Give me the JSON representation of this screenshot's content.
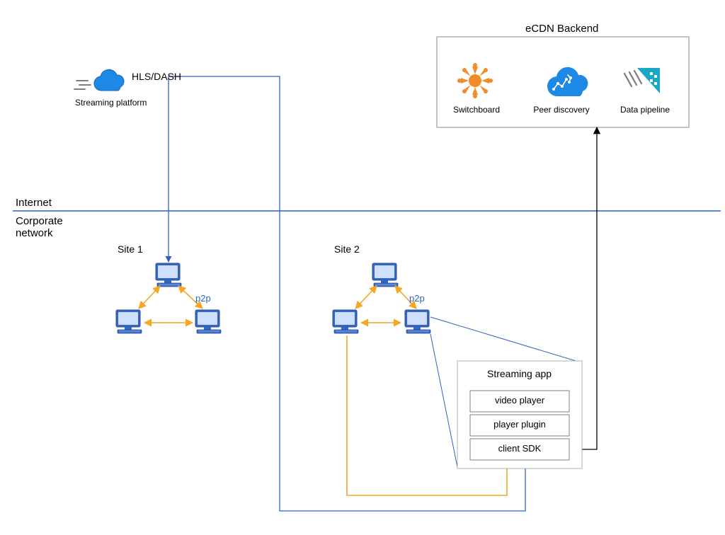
{
  "labels": {
    "streaming_platform": "Streaming platform",
    "hls_dash": "HLS/DASH",
    "internet": "Internet",
    "corporate_network": "Corporate\nnetwork",
    "site1": "Site 1",
    "site2": "Site 2",
    "p2p_1": "p2p",
    "p2p_2": "p2p",
    "ecdn_title": "eCDN Backend",
    "switchboard": "Switchboard",
    "peer_discovery": "Peer discovery",
    "data_pipeline": "Data pipeline",
    "streaming_app": "Streaming app",
    "video_player": "video player",
    "player_plugin": "player plugin",
    "client_sdk": "client SDK"
  },
  "colors": {
    "blue_stroke": "#2b63c1",
    "blue_fill": "#2a7de1",
    "cloud_blue": "#1e88e5",
    "orange": "#f6a623",
    "switch_orange": "#f28c28",
    "data_teal": "#1aa7c4",
    "black": "#000000",
    "grey": "#808080",
    "p2p_text": "#2b63c1"
  }
}
